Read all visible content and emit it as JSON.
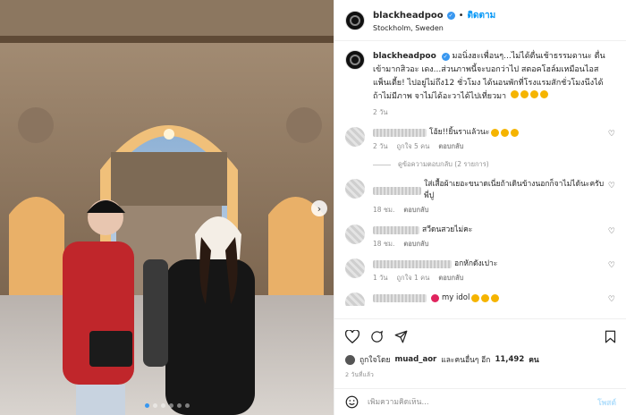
{
  "post": {
    "username": "blackheadpoo",
    "follow_label": "ติดตาม",
    "separator": "•",
    "location": "Stockholm, Sweden",
    "caption": "มอนิ่งฮะเพื่อนๆ...ไม่ได้ตื่นเช้าธรรมดานะ ตื่นเข้ามากสิวอะ เดง...ส่วนภาพนี้จะบอกว่าไป สตอคโฮล์มเหมือนไอสแพ็นเตี้ย! ไปอยู่ไม่ถึง12 ชั่วโมง ได้นอนพักที่โรงแรมสักชั่วโมงนึงได้ ถ้าไม่มีภาพ จาไม่ได้อะวาได้ไปเที่ยวมา",
    "caption_time": "2 วัน"
  },
  "comments": [
    {
      "text": "โอ้ย!!ยิ้นราแล้วนะ",
      "time": "2 วัน",
      "likes": "ถูกใจ 5 คน",
      "reply": "ตอบกลับ",
      "emoji": 3
    },
    {
      "text": "ใส่เสื้อผ้าเยอะขนาดเนี่ยถ้าเดินข้างนอกก็จาไม่ได้นะครับพี่ปู",
      "time": "18 ชม.",
      "likes": "",
      "reply": "ตอบกลับ",
      "emoji": 0
    },
    {
      "text": "สวีดนสวยไม่คะ",
      "time": "18 ชม.",
      "likes": "",
      "reply": "ตอบกลับ",
      "emoji": 0
    },
    {
      "text": "อกหักดังเปาะ",
      "time": "1 วัน",
      "likes": "ถูกใจ 1 คน",
      "reply": "ตอบกลับ",
      "emoji": 0
    },
    {
      "text": "my idol",
      "time": "",
      "likes": "",
      "reply": "",
      "emoji": 3
    }
  ],
  "view_replies": "ดูข้อความตอบกลับ (2 รายการ)",
  "likes_line": {
    "prefix": "ถูกใจโดย",
    "user": "muad_aor",
    "middle": "และคนอื่นๆ อีก",
    "count": "11,492",
    "suffix": "คน"
  },
  "post_date": "2 วันที่แล้ว",
  "composer": {
    "placeholder": "เพิ่มความคิดเห็น...",
    "post_label": "โพสต์"
  },
  "icons": {
    "like": "heart-icon",
    "comment": "comment-icon",
    "share": "share-icon",
    "save": "bookmark-icon",
    "emoji": "smiley-icon",
    "carousel": "chevron-right-icon"
  },
  "colors": {
    "link": "#0095f6",
    "muted": "#8e8e8e",
    "verified": "#3897f0",
    "text": "#262626"
  },
  "carousel": {
    "count": 6,
    "active": 0
  }
}
